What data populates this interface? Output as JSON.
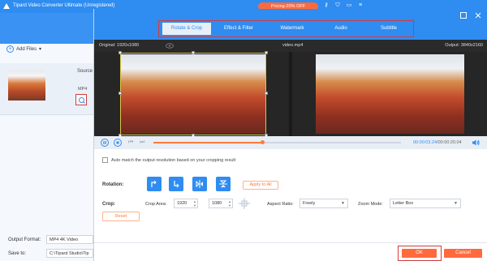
{
  "app": {
    "title": "Tipard Video Converter Ultimate (Unregistered)",
    "promo": "Pricing-20% OFF",
    "add_files": "Add Files",
    "source": "Source",
    "format_tag": "MP4",
    "output_format_label": "Output Format:",
    "output_format_value": "MP4 4K Video",
    "save_to_label": "Save to:",
    "save_to_value": "C:\\Tipard Studio\\Tip"
  },
  "dialog": {
    "tabs": [
      {
        "label": "Rotate & Crop",
        "active": true
      },
      {
        "label": "Effect & Filter",
        "active": false
      },
      {
        "label": "Watermark",
        "active": false
      },
      {
        "label": "Audio",
        "active": false
      },
      {
        "label": "Subtitle",
        "active": false
      }
    ],
    "original": "Original: 1920x1080",
    "filename": "video.mp4",
    "output": "Output: 3840x2160",
    "time_current": "00:00:03.24",
    "time_total": "/00:00:20.04",
    "progress": 0.44,
    "auto_match": "Auto match the output resolution based on your cropping result",
    "rotation_label": "Rotation:",
    "apply_to_all": "Apply to All",
    "crop_label": "Crop:",
    "crop_area_label": "Crop Area:",
    "crop_width": "1920",
    "crop_height": "1080",
    "aspect_ratio_label": "Aspect Ratio:",
    "aspect_ratio_value": "Freely",
    "zoom_mode_label": "Zoom Mode:",
    "zoom_mode_value": "Letter Box",
    "reset": "Reset",
    "ok": "OK",
    "cancel": "Cancel"
  },
  "colors": {
    "accent": "#2f8cf0",
    "orange": "#ff6a3c",
    "highlight": "#cf3c3c"
  }
}
